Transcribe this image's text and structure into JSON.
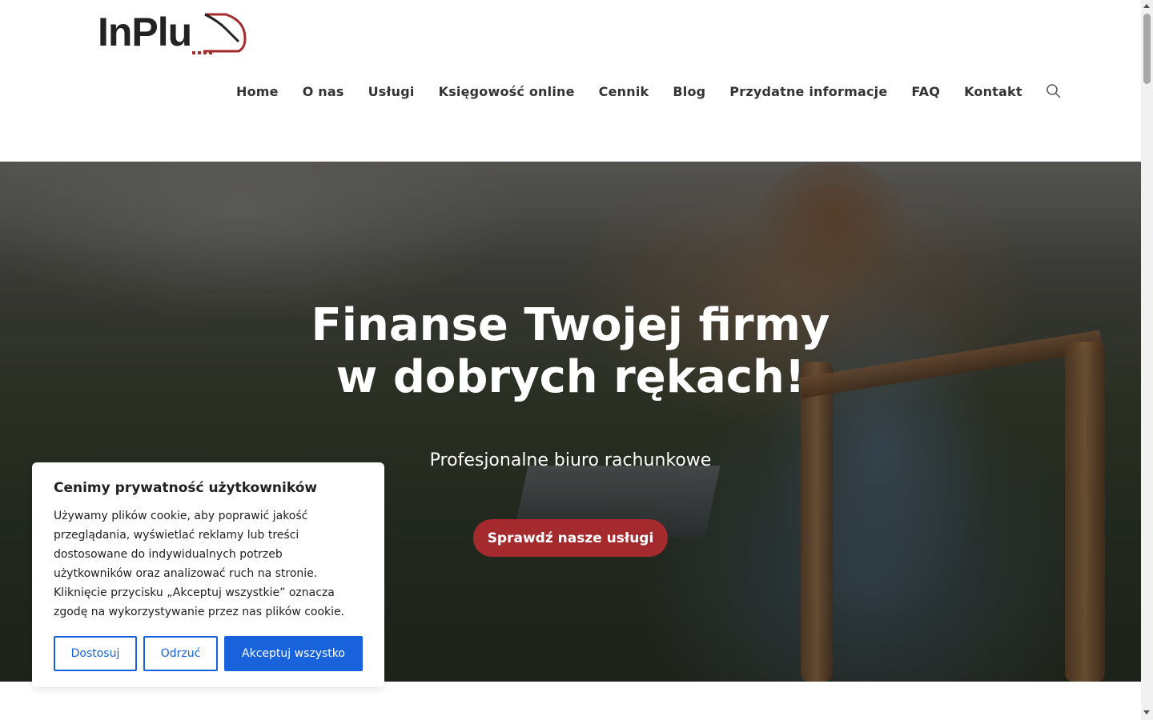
{
  "brand": {
    "logo_text": "InPlu",
    "accent": "#a52a2e"
  },
  "nav": {
    "items": [
      {
        "label": "Home"
      },
      {
        "label": "O nas"
      },
      {
        "label": "Usługi"
      },
      {
        "label": "Księgowość online"
      },
      {
        "label": "Cennik"
      },
      {
        "label": "Blog"
      },
      {
        "label": "Przydatne informacje"
      },
      {
        "label": "FAQ"
      },
      {
        "label": "Kontakt"
      }
    ],
    "search_icon": "search-icon"
  },
  "hero": {
    "title_line1": "Finanse Twojej firmy",
    "title_line2": "w dobrych rękach!",
    "subtitle": "Profesjonalne biuro rachunkowe",
    "cta_label": "Sprawdź nasze usługi",
    "cta_color": "#a52a2e"
  },
  "cookie": {
    "title": "Cenimy prywatność użytkowników",
    "body": "Używamy plików cookie, aby poprawić jakość przeglądania, wyświetlać reklamy lub treści dostosowane do indywidualnych potrzeb użytkowników oraz analizować ruch na stronie. Kliknięcie przycisku „Akceptuj wszystkie” oznacza zgodę na wykorzystywanie przez nas plików cookie.",
    "customize_label": "Dostosuj",
    "reject_label": "Odrzuć",
    "accept_label": "Akceptuj wszystko",
    "button_color": "#1863dc"
  }
}
